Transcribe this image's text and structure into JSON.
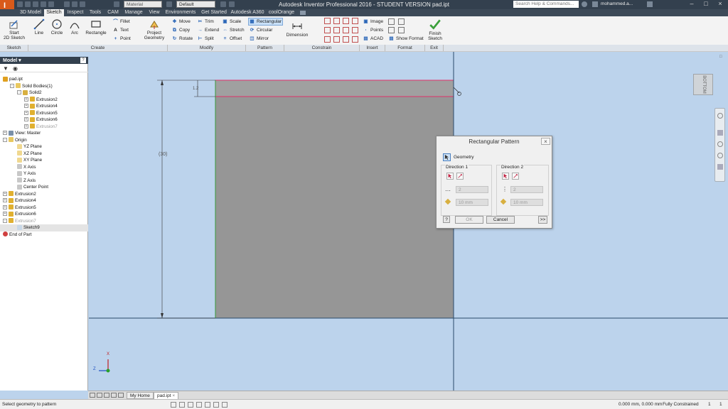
{
  "app": {
    "logo_text": "I",
    "logo_subtext": "PRO",
    "title": "Autodesk Inventor Professional 2016 - STUDENT VERSION    pad.ipt",
    "material_dropdown": "Material",
    "appearance_dropdown": "Default",
    "search_placeholder": "Search Help & Commands...",
    "user": "mohammed.a..."
  },
  "tabs": [
    "3D Model",
    "Sketch",
    "Inspect",
    "Tools",
    "CAM",
    "Manage",
    "View",
    "Environments",
    "Get Started",
    "Autodesk A360",
    "coolOrange"
  ],
  "active_tab": "Sketch",
  "ribbon": {
    "sketch": {
      "start_line1": "Start",
      "start_line2": "2D Sketch",
      "group": "Sketch"
    },
    "create": {
      "line": "Line",
      "circle": "Circle",
      "arc": "Arc",
      "rectangle": "Rectangle",
      "fillet": "Fillet",
      "text": "Text",
      "point": "Point",
      "project_line1": "Project",
      "project_line2": "Geometry",
      "group": "Create"
    },
    "modify": {
      "move": "Move",
      "copy": "Copy",
      "rotate": "Rotate",
      "trim": "Trim",
      "extend": "Extend",
      "split": "Split",
      "scale": "Scale",
      "stretch": "Stretch",
      "offset": "Offset",
      "group": "Modify"
    },
    "pattern": {
      "rectangular": "Rectangular",
      "circular": "Circular",
      "mirror": "Mirror",
      "group": "Pattern"
    },
    "constrain": {
      "dimension": "Dimension",
      "group": "Constrain"
    },
    "insert": {
      "image": "Image",
      "points": "Points",
      "acad": "ACAD",
      "group": "Insert"
    },
    "format": {
      "show_format": "Show Format",
      "group": "Format"
    },
    "exit": {
      "finish_line1": "Finish",
      "finish_line2": "Sketch",
      "group": "Exit"
    }
  },
  "browser": {
    "title": "Model",
    "items": [
      {
        "label": "pad.ipt",
        "indent": 0,
        "icon": "part-icon",
        "pm": ""
      },
      {
        "label": "Solid Bodies(1)",
        "indent": 1,
        "icon": "folder-icon",
        "pm": "-"
      },
      {
        "label": "Solid2",
        "indent": 2,
        "icon": "solid-icon",
        "pm": "-"
      },
      {
        "label": "Extrusion2",
        "indent": 3,
        "icon": "extrusion-icon",
        "pm": "+"
      },
      {
        "label": "Extrusion4",
        "indent": 3,
        "icon": "extrusion-icon",
        "pm": "+"
      },
      {
        "label": "Extrusion5",
        "indent": 3,
        "icon": "extrusion-icon",
        "pm": "+"
      },
      {
        "label": "Extrusion6",
        "indent": 3,
        "icon": "extrusion-icon",
        "pm": "+"
      },
      {
        "label": "Extrusion7",
        "indent": 3,
        "icon": "extrusion-icon",
        "pm": "+",
        "dim": true
      },
      {
        "label": "View: Master",
        "indent": 0,
        "icon": "view-icon",
        "pm": "+"
      },
      {
        "label": "Origin",
        "indent": 0,
        "icon": "folder-icon",
        "pm": "-"
      },
      {
        "label": "YZ Plane",
        "indent": 2,
        "icon": "plane-icon",
        "pm": ""
      },
      {
        "label": "XZ Plane",
        "indent": 2,
        "icon": "plane-icon",
        "pm": ""
      },
      {
        "label": "XY Plane",
        "indent": 2,
        "icon": "plane-icon",
        "pm": ""
      },
      {
        "label": "X Axis",
        "indent": 2,
        "icon": "axis-icon",
        "pm": ""
      },
      {
        "label": "Y Axis",
        "indent": 2,
        "icon": "axis-icon",
        "pm": ""
      },
      {
        "label": "Z Axis",
        "indent": 2,
        "icon": "axis-icon",
        "pm": ""
      },
      {
        "label": "Center Point",
        "indent": 2,
        "icon": "point-icon",
        "pm": ""
      },
      {
        "label": "Extrusion2",
        "indent": 0,
        "icon": "extrusion-icon",
        "pm": "+"
      },
      {
        "label": "Extrusion4",
        "indent": 0,
        "icon": "extrusion-icon",
        "pm": "+"
      },
      {
        "label": "Extrusion5",
        "indent": 0,
        "icon": "extrusion-icon",
        "pm": "+"
      },
      {
        "label": "Extrusion6",
        "indent": 0,
        "icon": "extrusion-icon",
        "pm": "+"
      },
      {
        "label": "Extrusion7",
        "indent": 0,
        "icon": "extrusion-icon",
        "pm": "-",
        "dim": true
      },
      {
        "label": "Sketch9",
        "indent": 2,
        "icon": "sketch-icon",
        "pm": "",
        "sel": true
      },
      {
        "label": "End of Part",
        "indent": 0,
        "icon": "end-of-part-icon",
        "pm": ""
      }
    ]
  },
  "canvas": {
    "dim_height": "(30)",
    "dim_small": "1.2",
    "viewcube": "BOTTOM",
    "axis_x": "X",
    "axis_z": "Z"
  },
  "dialog": {
    "title": "Rectangular Pattern",
    "geometry_label": "Geometry",
    "direction1": "Direction 1",
    "direction2": "Direction 2",
    "count1": "2",
    "count2": "2",
    "spacing1": "10 mm",
    "spacing2": "10 mm",
    "ok": "OK",
    "cancel": "Cancel",
    "more": ">>"
  },
  "doc_tabs": [
    "My Home",
    "pad.ipt"
  ],
  "status": {
    "prompt": "Select geometry to pattern",
    "coords": "0.000 mm, 0.000 mm",
    "constraint": "Fully Constrained",
    "count1": "1",
    "count2": "1"
  },
  "colors": {
    "title_bar": "#33404e",
    "ribbon": "#f3f3f3",
    "canvas": "#bcd3ec",
    "part_fill": "#969696",
    "accent_orange": "#d95a1a",
    "highlight_red": "#e0306a"
  }
}
